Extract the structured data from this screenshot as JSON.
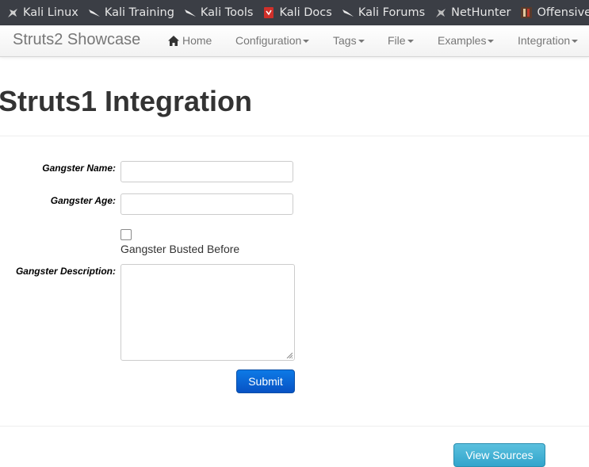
{
  "bookmarks": [
    {
      "label": "Kali Linux",
      "icon": "kali-dragon-icon"
    },
    {
      "label": "Kali Training",
      "icon": "kali-dragon-icon"
    },
    {
      "label": "Kali Tools",
      "icon": "kali-dragon-icon"
    },
    {
      "label": "Kali Docs",
      "icon": "kali-docs-icon"
    },
    {
      "label": "Kali Forums",
      "icon": "kali-dragon-icon"
    },
    {
      "label": "NetHunter",
      "icon": "kali-dragon-icon"
    },
    {
      "label": "Offensive Securi",
      "icon": "offsec-icon"
    }
  ],
  "navbar": {
    "brand": "Struts2 Showcase",
    "items": [
      {
        "label": "Home",
        "icon": "home-icon",
        "dropdown": false
      },
      {
        "label": "Configuration",
        "dropdown": true
      },
      {
        "label": "Tags",
        "dropdown": true
      },
      {
        "label": "File",
        "dropdown": true
      },
      {
        "label": "Examples",
        "dropdown": true
      },
      {
        "label": "Integration",
        "dropdown": true
      }
    ]
  },
  "page": {
    "title": "Struts1 Integration"
  },
  "form": {
    "name_label": "Gangster Name:",
    "name_value": "",
    "age_label": "Gangster Age:",
    "age_value": "",
    "busted_label": "Gangster Busted Before",
    "busted_checked": false,
    "description_label": "Gangster Description:",
    "description_value": "",
    "submit_label": "Submit"
  },
  "footer": {
    "view_sources_label": "View Sources"
  },
  "colors": {
    "bookmark_bar": "#3b3e45",
    "primary_button": "#0d6fd8",
    "info_button": "#46b4d6",
    "nav_text": "#777777"
  }
}
